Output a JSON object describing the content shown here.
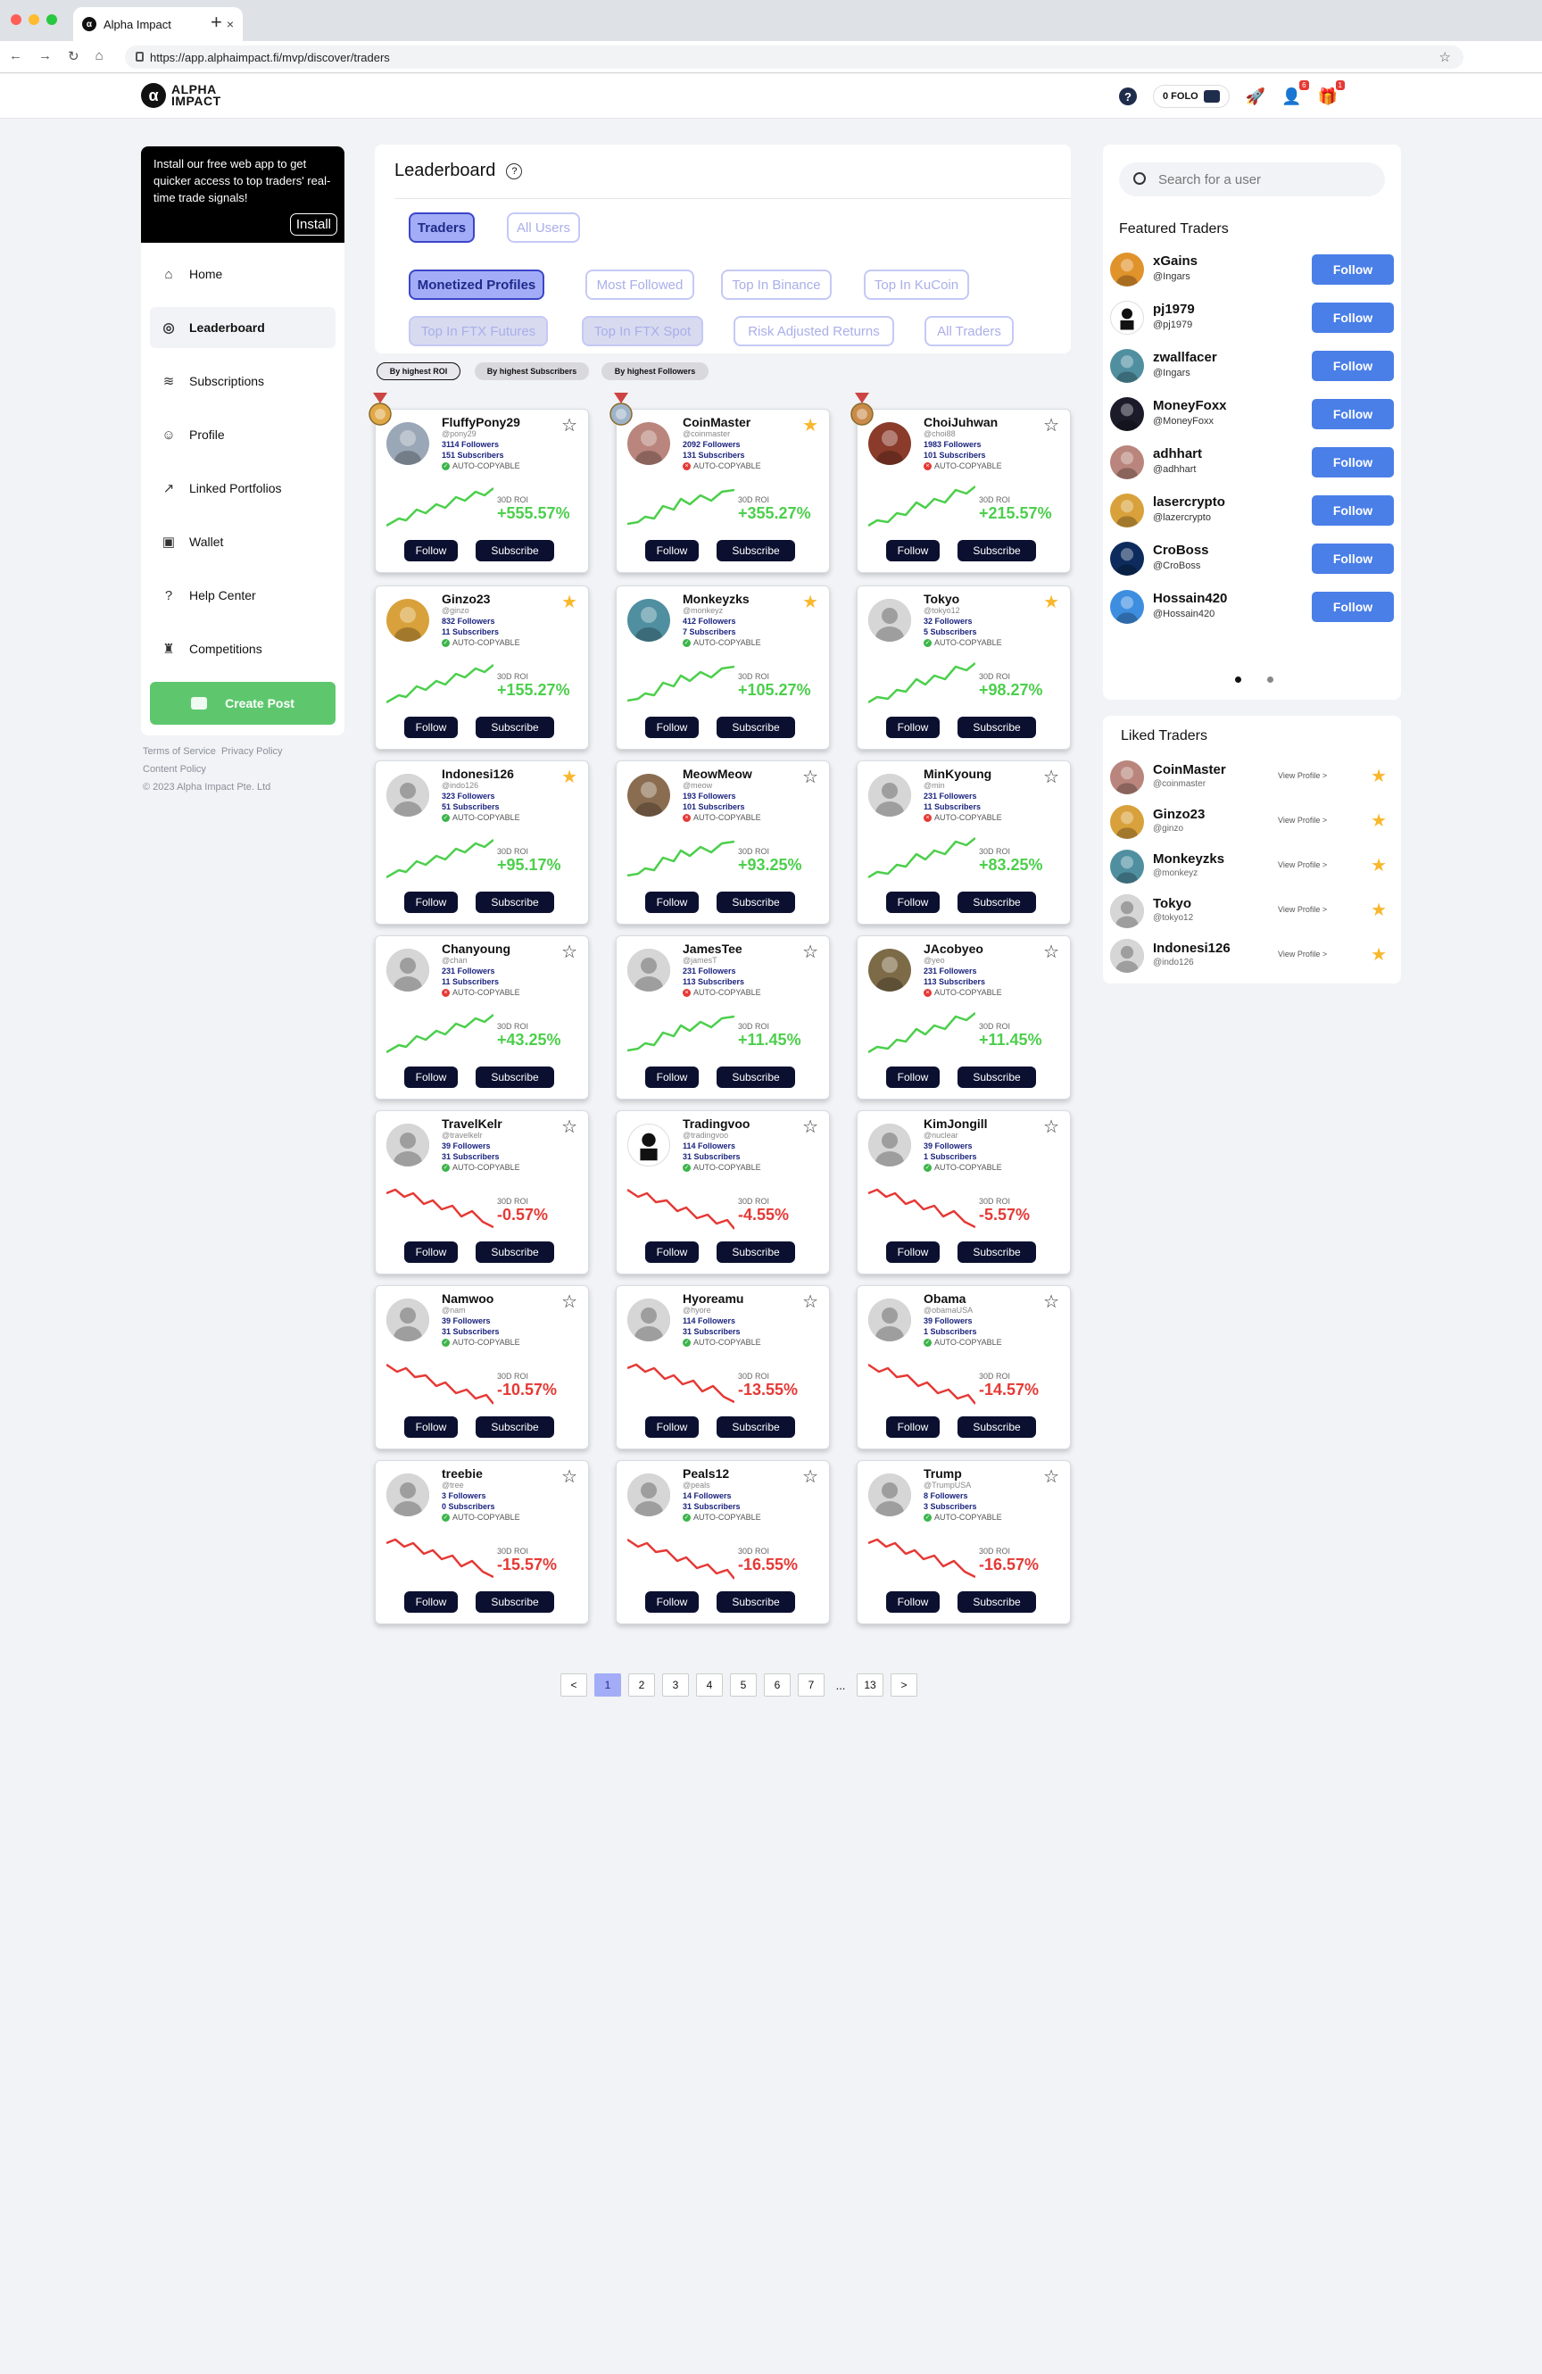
{
  "browser": {
    "tab_title": "Alpha Impact",
    "url": "https://app.alphaimpact.fi/mvp/discover/traders"
  },
  "topbar": {
    "logo_line1": "ALPHA",
    "logo_line2": "IMPACT",
    "folo": "0 FOLO",
    "notif_badge": "6",
    "gift_badge": "1"
  },
  "sidebar": {
    "install_text": "Install our free web app to get quicker access to top traders' real-time trade signals!",
    "install_button": "Install",
    "items": [
      {
        "label": "Home",
        "icon": "home-icon",
        "glyph": "⌂"
      },
      {
        "label": "Leaderboard",
        "icon": "globe-icon",
        "glyph": "◎"
      },
      {
        "label": "Subscriptions",
        "icon": "wifi-icon",
        "glyph": "≋"
      },
      {
        "label": "Profile",
        "icon": "user-icon",
        "glyph": "☺"
      },
      {
        "label": "Linked Portfolios",
        "icon": "chart-icon",
        "glyph": "↗"
      },
      {
        "label": "Wallet",
        "icon": "wallet-icon",
        "glyph": "▣"
      },
      {
        "label": "Help Center",
        "icon": "help-icon",
        "glyph": "?"
      },
      {
        "label": "Competitions",
        "icon": "trophy-icon",
        "glyph": "♜"
      }
    ],
    "create_post": "Create Post",
    "footer_terms": "Terms of Service",
    "footer_privacy": "Privacy Policy",
    "footer_content": "Content Policy",
    "footer_copy": "© 2023 Alpha Impact Pte. Ltd"
  },
  "leaderboard": {
    "title": "Leaderboard",
    "tabs": [
      "Traders",
      "All Users"
    ],
    "filters": [
      "Monetized Profiles",
      "Most Followed",
      "Top In Binance",
      "Top In KuCoin",
      "Top In FTX Futures",
      "Top In FTX Spot",
      "Risk Adjusted Returns",
      "All Traders"
    ],
    "sorts": [
      "By highest ROI",
      "By highest Subscribers",
      "By highest Followers"
    ],
    "roi_label": "30D ROI",
    "auto_label": "AUTO-COPYABLE",
    "follow_label": "Follow",
    "subscribe_label": "Subscribe"
  },
  "cards": [
    {
      "name": "FluffyPony29",
      "handle": "@pony29",
      "followers": "3114 Followers",
      "subscribers": "151 Subscribers",
      "roi": "+555.57%",
      "starred": false,
      "auto": true,
      "color": "#9aa7b6"
    },
    {
      "name": "CoinMaster",
      "handle": "@coinmaster",
      "followers": "2092 Followers",
      "subscribers": "131 Subscribers",
      "roi": "+355.27%",
      "starred": true,
      "auto": false,
      "color": "#b9857c"
    },
    {
      "name": "ChoiJuhwan",
      "handle": "@choi88",
      "followers": "1983 Followers",
      "subscribers": "101 Subscribers",
      "roi": "+215.57%",
      "starred": false,
      "auto": false,
      "color": "#8a3b2a"
    },
    {
      "name": "Ginzo23",
      "handle": "@ginzo",
      "followers": "832 Followers",
      "subscribers": "11 Subscribers",
      "roi": "+155.27%",
      "starred": true,
      "auto": true,
      "color": "#d9a13b"
    },
    {
      "name": "Monkeyzks",
      "handle": "@monkeyz",
      "followers": "412 Followers",
      "subscribers": "7 Subscribers",
      "roi": "+105.27%",
      "starred": true,
      "auto": true,
      "color": "#4f8fa0"
    },
    {
      "name": "Tokyo",
      "handle": "@tokyo12",
      "followers": "32 Followers",
      "subscribers": "5 Subscribers",
      "roi": "+98.27%",
      "starred": true,
      "auto": true,
      "color": "#b5b5b5"
    },
    {
      "name": "Indonesi126",
      "handle": "@indo126",
      "followers": "323 Followers",
      "subscribers": "51 Subscribers",
      "roi": "+95.17%",
      "starred": true,
      "auto": true,
      "color": "#b5b5b5"
    },
    {
      "name": "MeowMeow",
      "handle": "@meow",
      "followers": "193 Followers",
      "subscribers": "101 Subscribers",
      "roi": "+93.25%",
      "starred": false,
      "auto": false,
      "color": "#8a6d50"
    },
    {
      "name": "MinKyoung",
      "handle": "@min",
      "followers": "231 Followers",
      "subscribers": "11 Subscribers",
      "roi": "+83.25%",
      "starred": false,
      "auto": false,
      "color": "#b5b5b5"
    },
    {
      "name": "Chanyoung",
      "handle": "@chan",
      "followers": "231 Followers",
      "subscribers": "11 Subscribers",
      "roi": "+43.25%",
      "starred": false,
      "auto": false,
      "color": "#b5b5b5"
    },
    {
      "name": "JamesTee",
      "handle": "@jamesT",
      "followers": "231 Followers",
      "subscribers": "113 Subscribers",
      "roi": "+11.45%",
      "starred": false,
      "auto": false,
      "color": "#b5b5b5"
    },
    {
      "name": "JAcobyeo",
      "handle": "@yeo",
      "followers": "231 Followers",
      "subscribers": "113 Subscribers",
      "roi": "+11.45%",
      "starred": false,
      "auto": false,
      "color": "#7d6b48"
    },
    {
      "name": "TravelKelr",
      "handle": "@travelkelr",
      "followers": "39 Followers",
      "subscribers": "31 Subscribers",
      "roi": "-0.57%",
      "starred": false,
      "auto": true,
      "color": "#b5b5b5"
    },
    {
      "name": "Tradingvoo",
      "handle": "@tradingvoo",
      "followers": "114 Followers",
      "subscribers": "31 Subscribers",
      "roi": "-4.55%",
      "starred": false,
      "auto": true,
      "color": "#ffffff"
    },
    {
      "name": "KimJongill",
      "handle": "@nuclear",
      "followers": "39 Followers",
      "subscribers": "1 Subscribers",
      "roi": "-5.57%",
      "starred": false,
      "auto": true,
      "color": "#b5b5b5"
    },
    {
      "name": "Namwoo",
      "handle": "@nam",
      "followers": "39 Followers",
      "subscribers": "31 Subscribers",
      "roi": "-10.57%",
      "starred": false,
      "auto": true,
      "color": "#b5b5b5"
    },
    {
      "name": "Hyoreamu",
      "handle": "@hyore",
      "followers": "114 Followers",
      "subscribers": "31 Subscribers",
      "roi": "-13.55%",
      "starred": false,
      "auto": true,
      "color": "#b5b5b5"
    },
    {
      "name": "Obama",
      "handle": "@obamaUSA",
      "followers": "39 Followers",
      "subscribers": "1 Subscribers",
      "roi": "-14.57%",
      "starred": false,
      "auto": true,
      "color": "#b5b5b5"
    },
    {
      "name": "treebie",
      "handle": "@tree",
      "followers": "3 Followers",
      "subscribers": "0 Subscribers",
      "roi": "-15.57%",
      "starred": false,
      "auto": true,
      "color": "#b5b5b5"
    },
    {
      "name": "Peals12",
      "handle": "@peals",
      "followers": "14 Followers",
      "subscribers": "31 Subscribers",
      "roi": "-16.55%",
      "starred": false,
      "auto": true,
      "color": "#b5b5b5"
    },
    {
      "name": "Trump",
      "handle": "@TrumpUSA",
      "followers": "8 Followers",
      "subscribers": "3 Subscribers",
      "roi": "-16.57%",
      "starred": false,
      "auto": true,
      "color": "#b5b5b5"
    }
  ],
  "pagination": [
    "<",
    "1",
    "2",
    "3",
    "4",
    "5",
    "6",
    "7",
    "...",
    "13",
    ">"
  ],
  "search": {
    "placeholder": "Search for a user"
  },
  "featured": {
    "title": "Featured Traders",
    "button": "Follow",
    "items": [
      {
        "name": "xGains",
        "handle": "@Ingars",
        "color": "#e0922b"
      },
      {
        "name": "pj1979",
        "handle": "@pj1979",
        "color": "#ffffff"
      },
      {
        "name": "zwallfacer",
        "handle": "@Ingars",
        "color": "#4f8fa0"
      },
      {
        "name": "MoneyFoxx",
        "handle": "@MoneyFoxx",
        "color": "#1b1b2a"
      },
      {
        "name": "adhhart",
        "handle": "@adhhart",
        "color": "#b9857c"
      },
      {
        "name": "lasercrypto",
        "handle": "@lazercrypto",
        "color": "#d9a13b"
      },
      {
        "name": "CroBoss",
        "handle": "@CroBoss",
        "color": "#0d2b5c"
      },
      {
        "name": "Hossain420",
        "handle": "@Hossain420",
        "color": "#3e8ee0"
      }
    ]
  },
  "liked": {
    "title": "Liked Traders",
    "view_label": "View Profile >",
    "items": [
      {
        "name": "CoinMaster",
        "handle": "@coinmaster",
        "color": "#b9857c"
      },
      {
        "name": "Ginzo23",
        "handle": "@ginzo",
        "color": "#d9a13b"
      },
      {
        "name": "Monkeyzks",
        "handle": "@monkeyz",
        "color": "#4f8fa0"
      },
      {
        "name": "Tokyo",
        "handle": "@tokyo12",
        "color": "#b5b5b5"
      },
      {
        "name": "Indonesi126",
        "handle": "@indo126",
        "color": "#b5b5b5"
      }
    ]
  },
  "colors": {
    "accent": "#a3adf7",
    "follow_blue": "#4a7fe8",
    "positive": "#4ccf4c",
    "negative": "#e53935",
    "star": "#f9b72c",
    "dark_button": "#0b1030"
  }
}
